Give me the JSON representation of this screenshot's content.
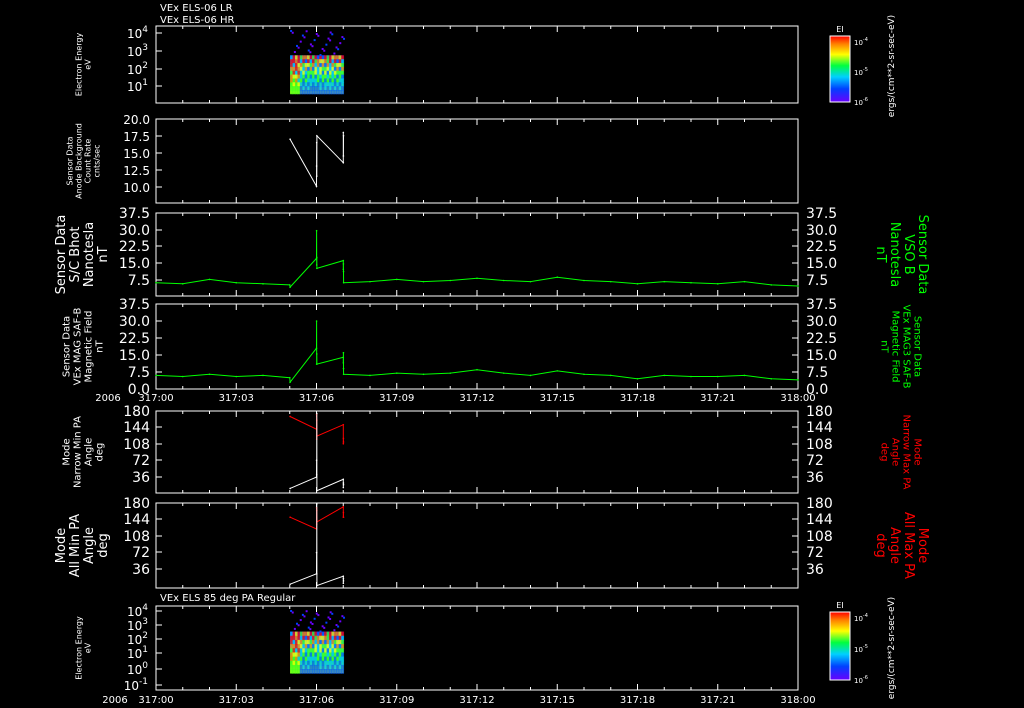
{
  "header_lines": [
    "VEx ELS-06 LR",
    "VEx ELS-06 HR"
  ],
  "colors": {
    "background": "#000000",
    "axes": "#ffffff",
    "white_trace": "#ffffff",
    "green_trace": "#00ff00",
    "red_trace": "#ff0000"
  },
  "time_axis": {
    "year_label": "2006",
    "ticks": [
      "317:00",
      "317:03",
      "317:06",
      "317:09",
      "317:12",
      "317:15",
      "317:18",
      "317:21",
      "318:00"
    ]
  },
  "chart_data": [
    {
      "type": "heatmap",
      "ylabel": [
        "Electron Energy",
        "eV"
      ],
      "ytick_labels": [
        "10^4",
        "10^3",
        "10^2",
        "10^1"
      ],
      "yscale": "log",
      "ylim": [
        1,
        10000
      ],
      "data_time_range": [
        "317:05:50",
        "317:07:40"
      ],
      "energy_range_ev": [
        3,
        300
      ],
      "colorbar": {
        "title": "EI",
        "tick_labels": [
          "10^-4",
          "10^-5",
          "10^-6"
        ],
        "unit_label": "ergs/(cm**2-sr-sec-eV)"
      }
    },
    {
      "type": "line",
      "ylabel": [
        "Sensor Data",
        "Anode Background",
        "Count Rate",
        "cnts/sec"
      ],
      "ytick_labels": [
        "20.0",
        "17.5",
        "15.0",
        "12.5",
        "10.0"
      ],
      "ylim": [
        7.5,
        20.0
      ],
      "series": [
        {
          "color": "#ffffff",
          "x": [
            "317:05:48",
            "317:06:00",
            "317:06:12",
            "317:06:24",
            "317:06:36",
            "317:06:48",
            "317:07:00",
            "317:07:12",
            "317:07:24",
            "317:07:36"
          ],
          "y": [
            17.0,
            10.0,
            13.0,
            16.5,
            11.5,
            17.5,
            13.5,
            18.0,
            14.5,
            17.5
          ]
        }
      ]
    },
    {
      "type": "line",
      "ylabel": [
        "Sensor Data",
        "S/C Bhot",
        "Nanotesla",
        "nT"
      ],
      "right_label": [
        "Sensor Data",
        "VSO B",
        "Nanotesla",
        "nT"
      ],
      "ytick_labels": [
        "37.5",
        "30.0",
        "22.5",
        "15.0",
        "7.5"
      ],
      "ylim": [
        0,
        37.5
      ],
      "series": [
        {
          "color": "#00ff00",
          "x": [
            "317:00",
            "317:01",
            "317:02",
            "317:03",
            "317:04",
            "317:05",
            "317:05:45",
            "317:06",
            "317:06:12",
            "317:06:24",
            "317:06:36",
            "317:06:48",
            "317:07",
            "317:07:12",
            "317:07:24",
            "317:07:36",
            "317:07:48",
            "317:08",
            "317:09",
            "317:10",
            "317:11",
            "317:12",
            "317:13",
            "317:14",
            "317:15",
            "317:16",
            "317:17",
            "317:18",
            "317:19",
            "317:20",
            "317:21",
            "317:22",
            "317:23",
            "318:00"
          ],
          "y": [
            6.0,
            5.5,
            7.5,
            6.0,
            5.5,
            5.0,
            4.0,
            17.0,
            29.5,
            14.0,
            17.5,
            12.5,
            16.0,
            12.0,
            14.5,
            11.0,
            6.0,
            6.5,
            7.5,
            6.5,
            7.0,
            8.0,
            7.0,
            6.5,
            8.5,
            7.0,
            6.5,
            5.5,
            6.5,
            6.0,
            5.5,
            6.5,
            5.0,
            4.5
          ]
        }
      ]
    },
    {
      "type": "line",
      "ylabel": [
        "Sensor Data",
        "VEx MAG SAF-B",
        "Magnetic Field",
        "nT"
      ],
      "right_label": [
        "Sensor Data",
        "VEx MAG3 SAF-B",
        "Magnetic Field",
        "nT"
      ],
      "ytick_labels": [
        "37.5",
        "30.0",
        "22.5",
        "15.0",
        "7.5",
        "0.0"
      ],
      "ylim": [
        0,
        37.5
      ],
      "series": [
        {
          "color": "#00ff00",
          "x": [
            "317:00",
            "317:01",
            "317:02",
            "317:03",
            "317:04",
            "317:05",
            "317:05:45",
            "317:06",
            "317:06:12",
            "317:06:24",
            "317:06:36",
            "317:06:48",
            "317:07",
            "317:07:12",
            "317:07:24",
            "317:07:36",
            "317:07:48",
            "317:08",
            "317:09",
            "317:10",
            "317:11",
            "317:12",
            "317:13",
            "317:14",
            "317:15",
            "317:16",
            "317:17",
            "317:18",
            "317:19",
            "317:20",
            "317:21",
            "317:22",
            "317:23",
            "318:00"
          ],
          "y": [
            6.0,
            5.5,
            6.5,
            5.5,
            6.0,
            5.0,
            3.0,
            18.0,
            30.0,
            11.0,
            15.5,
            11.0,
            14.0,
            11.5,
            16.0,
            9.0,
            6.5,
            6.0,
            7.0,
            6.5,
            7.0,
            8.5,
            7.0,
            6.0,
            8.0,
            6.5,
            6.0,
            4.5,
            6.0,
            5.5,
            5.5,
            6.0,
            4.5,
            4.0
          ]
        }
      ]
    },
    {
      "type": "line",
      "ylabel": [
        "Mode",
        "Narrow Min PA",
        "Angle",
        "deg"
      ],
      "right_label": [
        "Mode",
        "Narrow Max PA",
        "Angle",
        "deg"
      ],
      "ytick_labels": [
        "180",
        "144",
        "108",
        "72",
        "36"
      ],
      "ylim": [
        0,
        180
      ],
      "series": [
        {
          "color": "#ff0000",
          "x": [
            "317:05:50",
            "317:06:00",
            "317:06:12",
            "317:06:24",
            "317:06:36",
            "317:06:48",
            "317:07:00",
            "317:07:12",
            "317:07:24",
            "317:07:36"
          ],
          "y": [
            168,
            140,
            172,
            118,
            160,
            125,
            150,
            108,
            120,
            112
          ]
        },
        {
          "color": "#ffffff",
          "x": [
            "317:05:50",
            "317:06:00",
            "317:06:12",
            "317:06:24",
            "317:06:36",
            "317:06:48",
            "317:07:00",
            "317:07:12",
            "317:07:24",
            "317:07:36"
          ],
          "y": [
            10,
            35,
            72,
            40,
            175,
            5,
            30,
            12,
            22,
            18
          ]
        }
      ]
    },
    {
      "type": "line",
      "ylabel": [
        "Mode",
        "All Min PA",
        "Angle",
        "deg"
      ],
      "right_label": [
        "Mode",
        "All Max PA",
        "Angle",
        "deg"
      ],
      "ytick_labels": [
        "180",
        "144",
        "108",
        "72",
        "36"
      ],
      "ylim": [
        0,
        180
      ],
      "series": [
        {
          "color": "#ff0000",
          "x": [
            "317:05:50",
            "317:06:00",
            "317:06:12",
            "317:06:24",
            "317:06:36",
            "317:06:48",
            "317:07:00",
            "317:07:12",
            "317:07:24",
            "317:07:36"
          ],
          "y": [
            150,
            125,
            170,
            135,
            165,
            140,
            172,
            150,
            160,
            150
          ]
        },
        {
          "color": "#ffffff",
          "x": [
            "317:05:50",
            "317:06:00",
            "317:06:12",
            "317:06:24",
            "317:06:36",
            "317:06:48",
            "317:07:00",
            "317:07:12",
            "317:07:24",
            "317:07:36"
          ],
          "y": [
            8,
            30,
            75,
            30,
            178,
            5,
            25,
            10,
            20,
            15
          ]
        }
      ]
    },
    {
      "type": "heatmap",
      "title": "VEx ELS 85 deg PA Regular",
      "ylabel": [
        "Electron Energy",
        "eV"
      ],
      "ytick_labels": [
        "10^4",
        "10^3",
        "10^2",
        "10^1",
        "10^0",
        "10^-1"
      ],
      "yscale": "log",
      "ylim": [
        0.1,
        10000
      ],
      "data_time_range": [
        "317:05:50",
        "317:07:40"
      ],
      "energy_range_ev": [
        1,
        300
      ],
      "colorbar": {
        "title": "EI",
        "tick_labels": [
          "10^-4",
          "10^-5",
          "10^-6"
        ],
        "unit_label": "ergs/(cm**2-sr-sec-eV)"
      }
    }
  ]
}
